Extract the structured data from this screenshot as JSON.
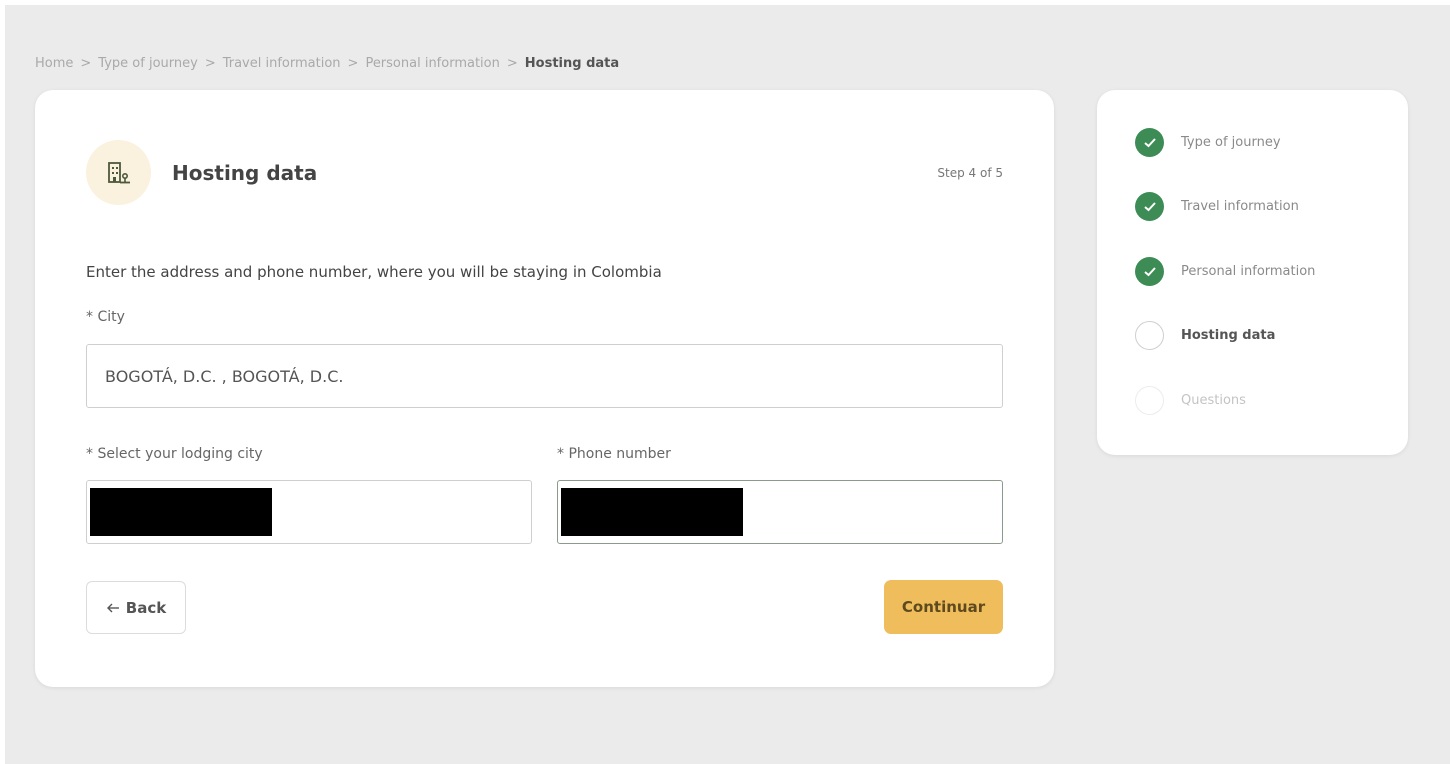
{
  "breadcrumb": {
    "items": [
      "Home",
      "Type of journey",
      "Travel information",
      "Personal information"
    ],
    "current": "Hosting data",
    "separator": ">"
  },
  "form": {
    "icon": "building-icon",
    "title": "Hosting data",
    "step_text": "Step 4 of 5",
    "instructions": "Enter the address and phone number, where you will be staying in Colombia",
    "city_label": "* City",
    "city_value": "BOGOTÁ, D.C. , BOGOTÁ, D.C.",
    "lodging_city_label": "* Select your lodging city",
    "phone_label": "* Phone number",
    "back_label": "Back",
    "back_icon": "arrow-left-icon",
    "continue_label": "Continuar"
  },
  "steps": [
    {
      "label": "Type of journey",
      "state": "done"
    },
    {
      "label": "Travel information",
      "state": "done"
    },
    {
      "label": "Personal information",
      "state": "done"
    },
    {
      "label": "Hosting data",
      "state": "active"
    },
    {
      "label": "Questions",
      "state": "pending"
    }
  ],
  "colors": {
    "accent": "#efbd5c",
    "done": "#3d8c55",
    "background": "#ebebeb"
  }
}
